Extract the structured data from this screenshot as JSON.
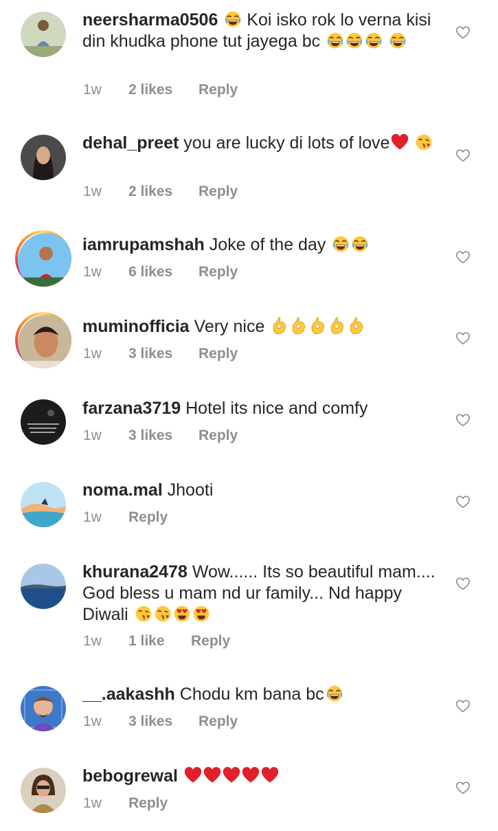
{
  "comments": [
    {
      "username": "neersharma0506",
      "text_before": "",
      "text": "Koi isko rok lo verna kisi din khudka phone tut jayega bc",
      "time": "1w",
      "likes": "2 likes",
      "reply": "Reply"
    },
    {
      "username": "dehal_preet",
      "text": "you are lucky di lots of love",
      "time": "1w",
      "likes": "2 likes",
      "reply": "Reply"
    },
    {
      "username": "iamrupamshah",
      "text": "Joke of the day",
      "time": "1w",
      "likes": "6 likes",
      "reply": "Reply"
    },
    {
      "username": "muminofficia",
      "text": "Very  nice",
      "time": "1w",
      "likes": "3 likes",
      "reply": "Reply"
    },
    {
      "username": "farzana3719",
      "text": "Hotel its nice and comfy",
      "time": "1w",
      "likes": "3 likes",
      "reply": "Reply"
    },
    {
      "username": "noma.mal",
      "text": "Jhooti",
      "time": "1w",
      "likes": "",
      "reply": "Reply"
    },
    {
      "username": "khurana2478",
      "text": "Wow...... Its so beautiful mam.... God bless u mam nd ur family... Nd happy Diwali",
      "time": "1w",
      "likes": "1 like",
      "reply": "Reply"
    },
    {
      "username": "__.aakashh",
      "text": "Chodu km bana bc",
      "time": "1w",
      "likes": "3 likes",
      "reply": "Reply"
    },
    {
      "username": "bebogrewal",
      "text": "",
      "time": "1w",
      "likes": "",
      "reply": "Reply"
    }
  ],
  "icons": {
    "like": "heart-outline-icon",
    "emoji_laugh": "tears-of-joy-emoji",
    "emoji_heart": "red-heart-emoji",
    "emoji_kiss": "face-blowing-kiss-emoji",
    "emoji_ok": "ok-hand-emoji",
    "emoji_hearteyes": "heart-eyes-emoji"
  },
  "colors": {
    "text": "#262626",
    "secondary": "#8e8e8e",
    "story_ring": "#d62976"
  }
}
